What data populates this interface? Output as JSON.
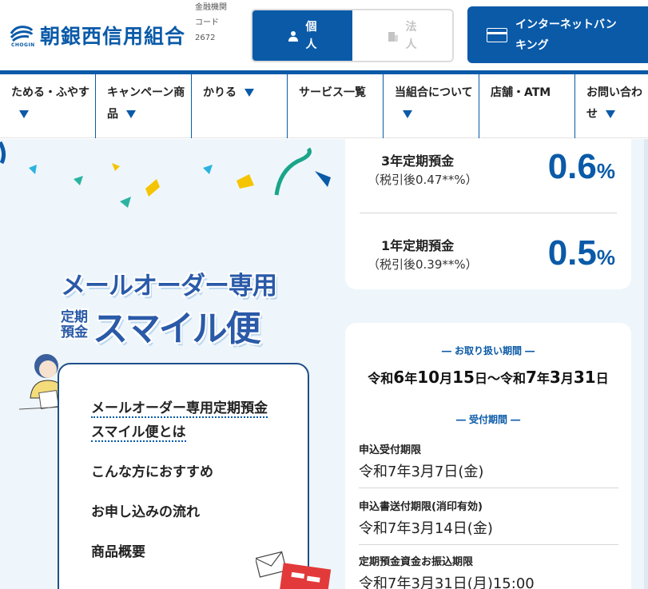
{
  "header": {
    "logo_text": "朝銀西信用組合",
    "logo_sub": "CHOGIN",
    "bank_code_label": "金融機関コード",
    "bank_code": "2672",
    "segments": [
      {
        "label": "個人",
        "icon": "person-icon",
        "active": true
      },
      {
        "label": "法人",
        "icon": "building-icon",
        "active": false
      }
    ],
    "netbank_label": "インターネットバンキング",
    "netbank_icon": "bank-card-icon",
    "accent_color": "#0a5aa8"
  },
  "nav": {
    "items": [
      {
        "label": "ためる・ふやす",
        "has_dropdown": true
      },
      {
        "label": "キャンペーン商品",
        "has_dropdown": true
      },
      {
        "label": "かりる",
        "has_dropdown": true
      },
      {
        "label": "サービス一覧",
        "has_dropdown": false
      },
      {
        "label": "当組合について",
        "has_dropdown": true
      },
      {
        "label": "店舗・ATM",
        "has_dropdown": false
      },
      {
        "label": "お問い合わせ",
        "has_dropdown": true
      }
    ]
  },
  "hero": {
    "title_line1": "メールオーダー専用",
    "title_small": "定期預金",
    "title_big": "スマイル便"
  },
  "toc": {
    "items": [
      {
        "label": "メールオーダー専用定期預金スマイル便とは",
        "current": true
      },
      {
        "label": "こんな方におすすめ",
        "current": false
      },
      {
        "label": "お申し込みの流れ",
        "current": false
      },
      {
        "label": "商品概要",
        "current": false
      }
    ]
  },
  "rates": [
    {
      "name": "3年定期預金",
      "after_tax": "（税引後0.47**%）",
      "value": "0.6",
      "unit": "%"
    },
    {
      "name": "1年定期預金",
      "after_tax": "（税引後0.39**%）",
      "value": "0.5",
      "unit": "%"
    }
  ],
  "period": {
    "handling_heading": "― お取り扱い期間 ―",
    "range": {
      "era1": "令和",
      "y1": "6",
      "y1u": "年",
      "m1": "10",
      "m1u": "月",
      "d1": "15",
      "d1u": "日",
      "sep": "〜",
      "era2": "令和",
      "y2": "7",
      "y2u": "年",
      "m2": "3",
      "m2u": "月",
      "d2": "31",
      "d2u": "日"
    },
    "accept_heading": "― 受付期間 ―",
    "entries": [
      {
        "label": "申込受付期限",
        "value": "令和7年3月7日(金)"
      },
      {
        "label": "申込書送付期限(消印有効)",
        "value": "令和7年3月14日(金)"
      },
      {
        "label": "定期預金資金お振込期限",
        "value": "令和7年3月31日(月)15:00"
      }
    ]
  }
}
